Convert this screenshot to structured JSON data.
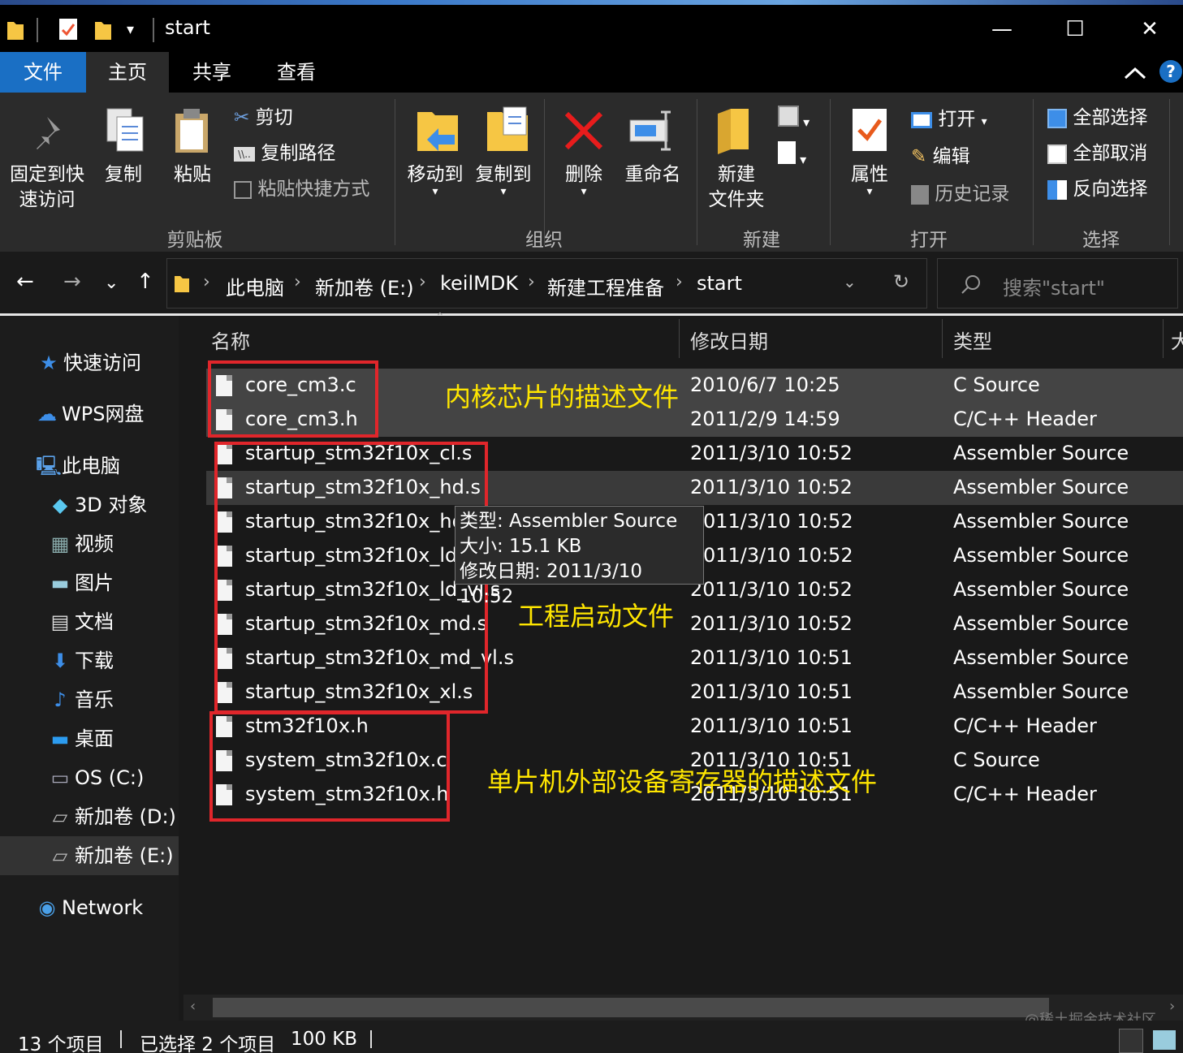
{
  "window": {
    "title": "start",
    "minimize_glyph": "—",
    "maximize_glyph": "☐",
    "close_glyph": "✕"
  },
  "tabs": [
    "文件",
    "主页",
    "共享",
    "查看"
  ],
  "ribbon": {
    "clipboard": {
      "pin_line1": "固定到快",
      "pin_line2": "速访问",
      "copy": "复制",
      "paste": "粘贴",
      "cut": "剪切",
      "copy_path": "复制路径",
      "paste_shortcut": "粘贴快捷方式",
      "group": "剪贴板"
    },
    "organize": {
      "move_to": "移动到",
      "copy_to": "复制到",
      "delete": "删除",
      "rename": "重命名",
      "group": "组织"
    },
    "new": {
      "folder_line1": "新建",
      "folder_line2": "文件夹",
      "group": "新建"
    },
    "open": {
      "properties": "属性",
      "open": "打开",
      "edit": "编辑",
      "history": "历史记录",
      "group": "打开"
    },
    "select": {
      "select_all": "全部选择",
      "select_none": "全部取消",
      "invert": "反向选择",
      "group": "选择"
    }
  },
  "address": {
    "crumbs": [
      "此电脑",
      "新加卷 (E:)",
      "keilMDK",
      "新建工程准备",
      "start"
    ],
    "search_placeholder": "搜索\"start\""
  },
  "nav": {
    "quick_access": "快速访问",
    "wps": "WPS网盘",
    "this_pc": "此电脑",
    "objects3d": "3D 对象",
    "videos": "视频",
    "pictures": "图片",
    "documents": "文档",
    "downloads": "下载",
    "music": "音乐",
    "desktop": "桌面",
    "os_c": "OS (C:)",
    "vol_d": "新加卷 (D:)",
    "vol_e": "新加卷 (E:)",
    "network": "Network"
  },
  "columns": {
    "name": "名称",
    "date": "修改日期",
    "type": "类型",
    "size": "大"
  },
  "files": [
    {
      "name": "core_cm3.c",
      "date": "2010/6/7 10:25",
      "type": "C Source"
    },
    {
      "name": "core_cm3.h",
      "date": "2011/2/9 14:59",
      "type": "C/C++ Header"
    },
    {
      "name": "startup_stm32f10x_cl.s",
      "date": "2011/3/10 10:52",
      "type": "Assembler Source"
    },
    {
      "name": "startup_stm32f10x_hd.s",
      "date": "2011/3/10 10:52",
      "type": "Assembler Source"
    },
    {
      "name": "startup_stm32f10x_hd_",
      "date": "011/3/10 10:52",
      "type": "Assembler Source"
    },
    {
      "name": "startup_stm32f10x_ld.s",
      "date": "011/3/10 10:52",
      "type": "Assembler Source"
    },
    {
      "name": "startup_stm32f10x_ld_vl.s",
      "date": "2011/3/10 10:52",
      "type": "Assembler Source"
    },
    {
      "name": "startup_stm32f10x_md.s",
      "date": "2011/3/10 10:52",
      "type": "Assembler Source"
    },
    {
      "name": "startup_stm32f10x_md_vl.s",
      "date": "2011/3/10 10:51",
      "type": "Assembler Source"
    },
    {
      "name": "startup_stm32f10x_xl.s",
      "date": "2011/3/10 10:51",
      "type": "Assembler Source"
    },
    {
      "name": "stm32f10x.h",
      "date": "2011/3/10 10:51",
      "type": "C/C++ Header"
    },
    {
      "name": "system_stm32f10x.c",
      "date": "2011/3/10 10:51",
      "type": "C Source"
    },
    {
      "name": "system_stm32f10x.h",
      "date": "2011/3/10 10:51",
      "type": "C/C++ Header"
    }
  ],
  "tooltip": {
    "type": "类型: Assembler Source",
    "size": "大小: 15.1 KB",
    "date": "修改日期: 2011/3/10 10:52"
  },
  "annotations": {
    "core": "内核芯片的描述文件",
    "startup": "工程启动文件",
    "peripheral": "单片机外部设备寄存器的描述文件"
  },
  "status": {
    "count": "13 个项目",
    "selected": "已选择 2 个项目",
    "size": "100 KB"
  },
  "watermark": "@稀土掘金技术社区",
  "colors": {
    "accent": "#1a6fc4",
    "annotation_box": "#e0262b",
    "annotation_text": "#ffe600"
  }
}
